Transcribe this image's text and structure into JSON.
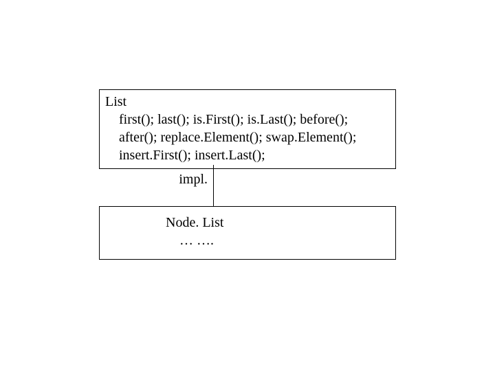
{
  "top": {
    "title": "List",
    "line1": "first(); last(); is.First(); is.Last(); before();",
    "line2": "after(); replace.Element(); swap.Element();",
    "line3": "insert.First(); insert.Last();"
  },
  "relation": {
    "label": "impl."
  },
  "bottom": {
    "title": "Node. List",
    "body": "… …."
  }
}
